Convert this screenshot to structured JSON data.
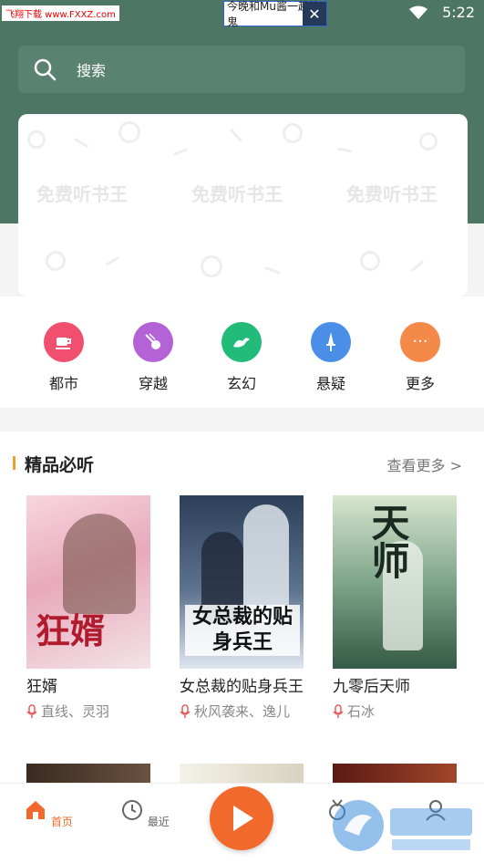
{
  "status_bar": {
    "site_watermark": "飞翔下载 www.FXXZ.com",
    "notification_text": "今晚和Mu酱一起捣鬼",
    "time": "5:22"
  },
  "search": {
    "placeholder_label": "搜索"
  },
  "banner": {
    "texts": [
      "免费听书王",
      "免费听书王",
      "免费听书王"
    ]
  },
  "categories": [
    {
      "label": "都市",
      "icon": "coffee-cup-icon",
      "color": "#f0506e"
    },
    {
      "label": "穿越",
      "icon": "meteor-icon",
      "color": "#b463d6"
    },
    {
      "label": "玄幻",
      "icon": "dragon-icon",
      "color": "#22bb7a"
    },
    {
      "label": "悬疑",
      "icon": "dagger-icon",
      "color": "#4a8ee8"
    },
    {
      "label": "更多",
      "icon": "more-dots-icon",
      "color": "#f5894a"
    }
  ],
  "featured": {
    "title": "精品必听",
    "more_label": "查看更多 >",
    "books": [
      {
        "title": "狂婿",
        "author": "直线、灵羽",
        "cover_text": "狂婿"
      },
      {
        "title": "女总裁的贴身兵王",
        "author": "秋风袭来、逸儿",
        "cover_text": "女总裁的贴身兵王"
      },
      {
        "title": "九零后天师",
        "author": "石冰",
        "cover_text": "天师"
      }
    ]
  },
  "tabbar": {
    "tabs": [
      {
        "label": "首页",
        "active": true
      },
      {
        "label": "最近",
        "active": false
      }
    ]
  },
  "colors": {
    "accent": "#f26a2b",
    "header_green": "#4d7664"
  }
}
